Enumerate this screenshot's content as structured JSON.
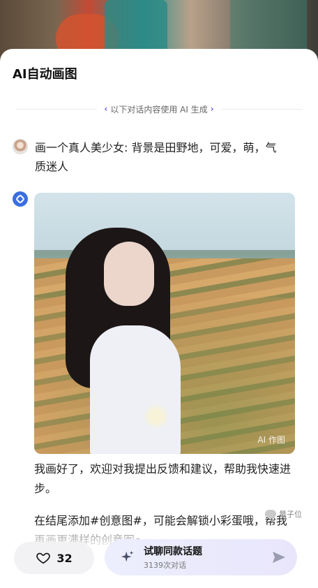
{
  "sheet": {
    "title": "AI自动画图",
    "divider_label": "以下对话内容使用 AI 生成"
  },
  "user_message": {
    "text": "画一个真人美少女: 背景是田野地，可爱，萌，气质迷人"
  },
  "bot": {
    "image_watermark": "AI 作图",
    "reply_text": "我画好了，欢迎对我提出反馈和建议，帮助我快速进步。",
    "followup_text": "在结尾添加#创意图#，可能会解锁小彩蛋哦，帮我再画更满样的创意图～"
  },
  "bottom_bar": {
    "like_count": "32",
    "try_title": "试聊同款话题",
    "try_subtitle": "3139次对话"
  },
  "watermark": {
    "label": "量子位"
  },
  "colors": {
    "accent": "#6b5ce7",
    "bot_avatar": "#3b6fe0",
    "sheet_bg": "#ffffff"
  }
}
